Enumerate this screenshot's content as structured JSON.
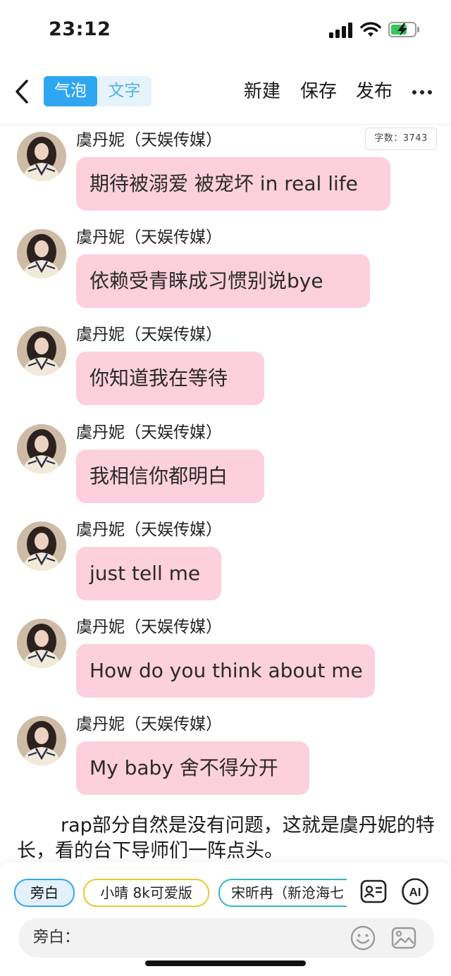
{
  "status_bar": {
    "time": "23:12"
  },
  "nav": {
    "back_icon": "chevron-left-icon",
    "tabs": [
      {
        "label": "气泡",
        "active": true
      },
      {
        "label": "文字",
        "active": false
      }
    ],
    "actions": [
      "新建",
      "保存",
      "发布"
    ],
    "more_icon": "ellipsis-icon"
  },
  "word_count": "字数：3743",
  "messages": [
    {
      "sender": "虞丹妮（天娱传媒）",
      "text": "期待被溺爱 被宠坏 in real life"
    },
    {
      "sender": "虞丹妮（天娱传媒）",
      "text": "依赖受青睐成习惯别说bye"
    },
    {
      "sender": "虞丹妮（天娱传媒）",
      "text": "你知道我在等待"
    },
    {
      "sender": "虞丹妮（天娱传媒）",
      "text": "我相信你都明白"
    },
    {
      "sender": "虞丹妮（天娱传媒）",
      "text": "just tell me"
    },
    {
      "sender": "虞丹妮（天娱传媒）",
      "text": "How do you think about me"
    },
    {
      "sender": "虞丹妮（天娱传媒）",
      "text": "My baby 舍不得分开"
    }
  ],
  "narration": "rap部分自然是没有问题，这就是虞丹妮的特长，看的台下导师们一阵点头。",
  "bottom": {
    "chips": [
      {
        "label": "旁白",
        "color": "#2fa7f0"
      },
      {
        "label": "小晴 8k可爱版",
        "color": "#e9c834"
      },
      {
        "label": "宋昕冉（新沧海七",
        "color": "#33b7c0"
      }
    ],
    "contact_icon": "contact-card-icon",
    "ai_label": "AI",
    "input_label": "旁白：",
    "emoji_icon": "emoji-icon",
    "image_icon": "image-icon"
  },
  "colors": {
    "accent": "#2fa7f0",
    "bubble": "#fcd0dc"
  }
}
